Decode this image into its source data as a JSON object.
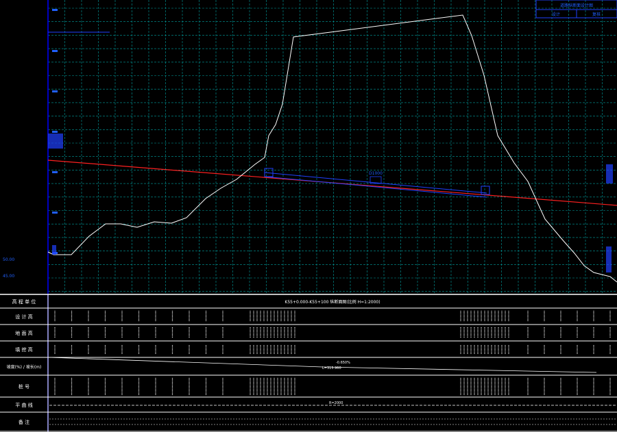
{
  "drawing": {
    "colors": {
      "background": "#000000",
      "grid": "#00a0a0",
      "frame": "#ffffff",
      "axis": "#0000ff",
      "ground_line": "#ffffff",
      "design_line": "#ff2020",
      "pipe": "#2040ff",
      "label_blue": "#2060ff"
    },
    "row_labels": [
      "高 程 单 位",
      "设 计 高",
      "地 面 高",
      "填 挖 高",
      "坡度(%) / 坡长(m)",
      "桩 号",
      "平 曲 线",
      "备 注"
    ],
    "left_labels": [
      "50.00",
      "45.00"
    ],
    "header_title": "K55+0.000-K55+100 纵断面图(比例 H=1:2000)",
    "slope_label": "-0.650%",
    "slope_length": "L=315.960",
    "pipe_label": "D1000",
    "curve_label": "R=2000",
    "title_block": [
      "道路纵断面设计图",
      "设计",
      "复核"
    ]
  }
}
